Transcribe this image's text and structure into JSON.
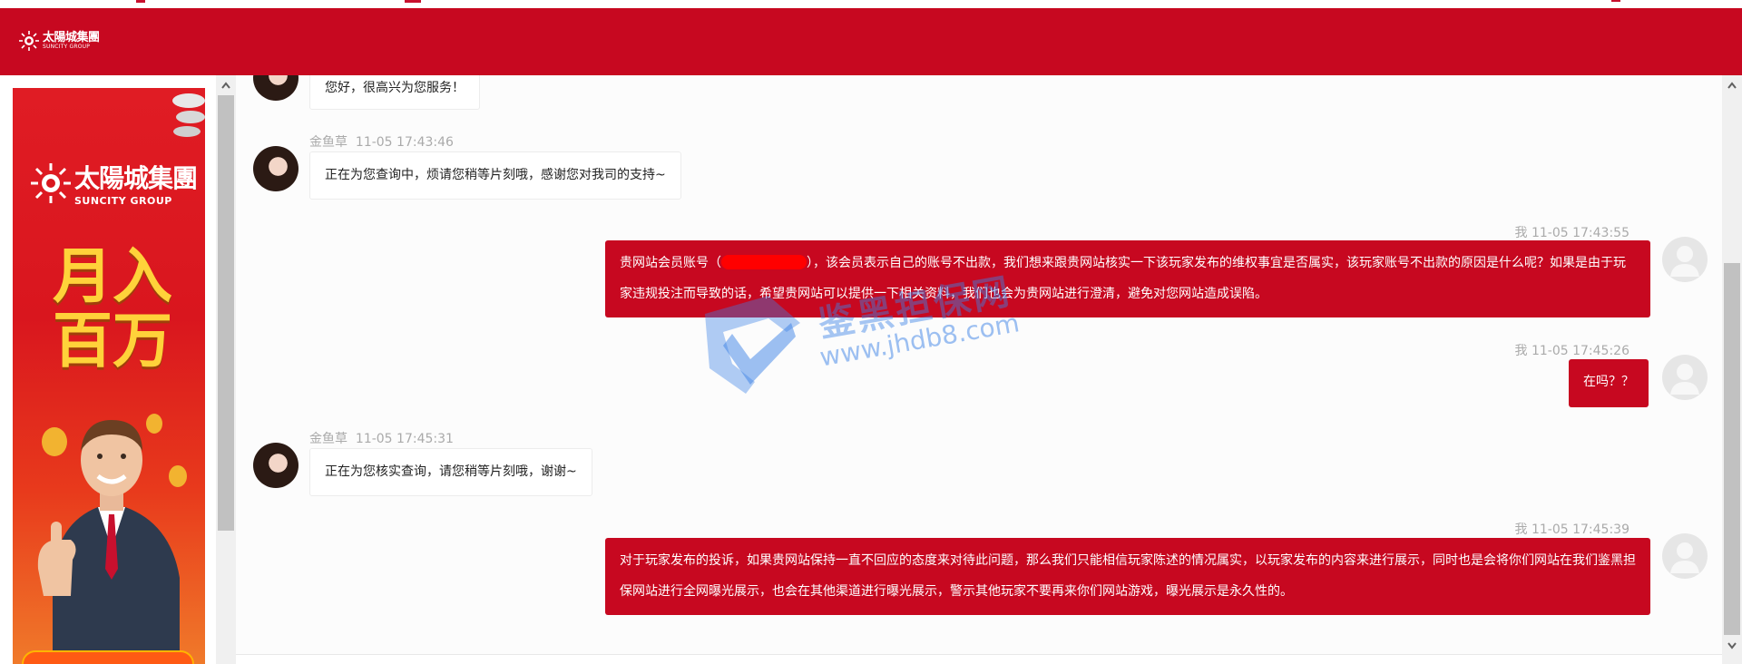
{
  "brand": {
    "logo_cn": "太陽城集團",
    "logo_en": "SUNCITY GROUP"
  },
  "ad": {
    "logo_cn": "太陽城集團",
    "logo_en": "SUNCITY GROUP",
    "slogan_line1": "月入",
    "slogan_line2": "百万"
  },
  "watermark": {
    "text_cn": "鉴黑担保网",
    "url": "www.jhdb8.com"
  },
  "messages": [
    {
      "from": "agent",
      "text": "您好，很高兴为您服务！"
    },
    {
      "from": "agent",
      "name": "金鱼草",
      "time": "11-05 17:43:46",
      "text": "正在为您查询中，烦请您稍等片刻哦，感谢您对我司的支持~"
    },
    {
      "from": "user",
      "name": "我",
      "time": "11-05 17:43:55",
      "text_before": "贵网站会员账号（",
      "text_after": "），该会员表示自己的账号不出款，我们想来跟贵网站核实一下该玩家发布的维权事宜是否属实，该玩家账号不出款的原因是什么呢？如果是由于玩家违规投注而导致的话，希望贵网站可以提供一下相关资料，我们也会为贵网站进行澄清，避免对您网站造成误陷。"
    },
    {
      "from": "user",
      "name": "我",
      "time": "11-05 17:45:26",
      "text": "在吗？？"
    },
    {
      "from": "agent",
      "name": "金鱼草",
      "time": "11-05 17:45:31",
      "text": "正在为您核实查询，请您稍等片刻哦，谢谢~"
    },
    {
      "from": "user",
      "name": "我",
      "time": "11-05 17:45:39",
      "text": "对于玩家发布的投诉，如果贵网站保持一直不回应的态度来对待此问题，那么我们只能相信玩家陈述的情况属实，以玩家发布的内容来进行展示，同时也是会将你们网站在我们鉴黑担保网站进行全网曝光展示，也会在其他渠道进行曝光展示，警示其他玩家不要再来你们网站游戏，曝光展示是永久性的。"
    }
  ]
}
